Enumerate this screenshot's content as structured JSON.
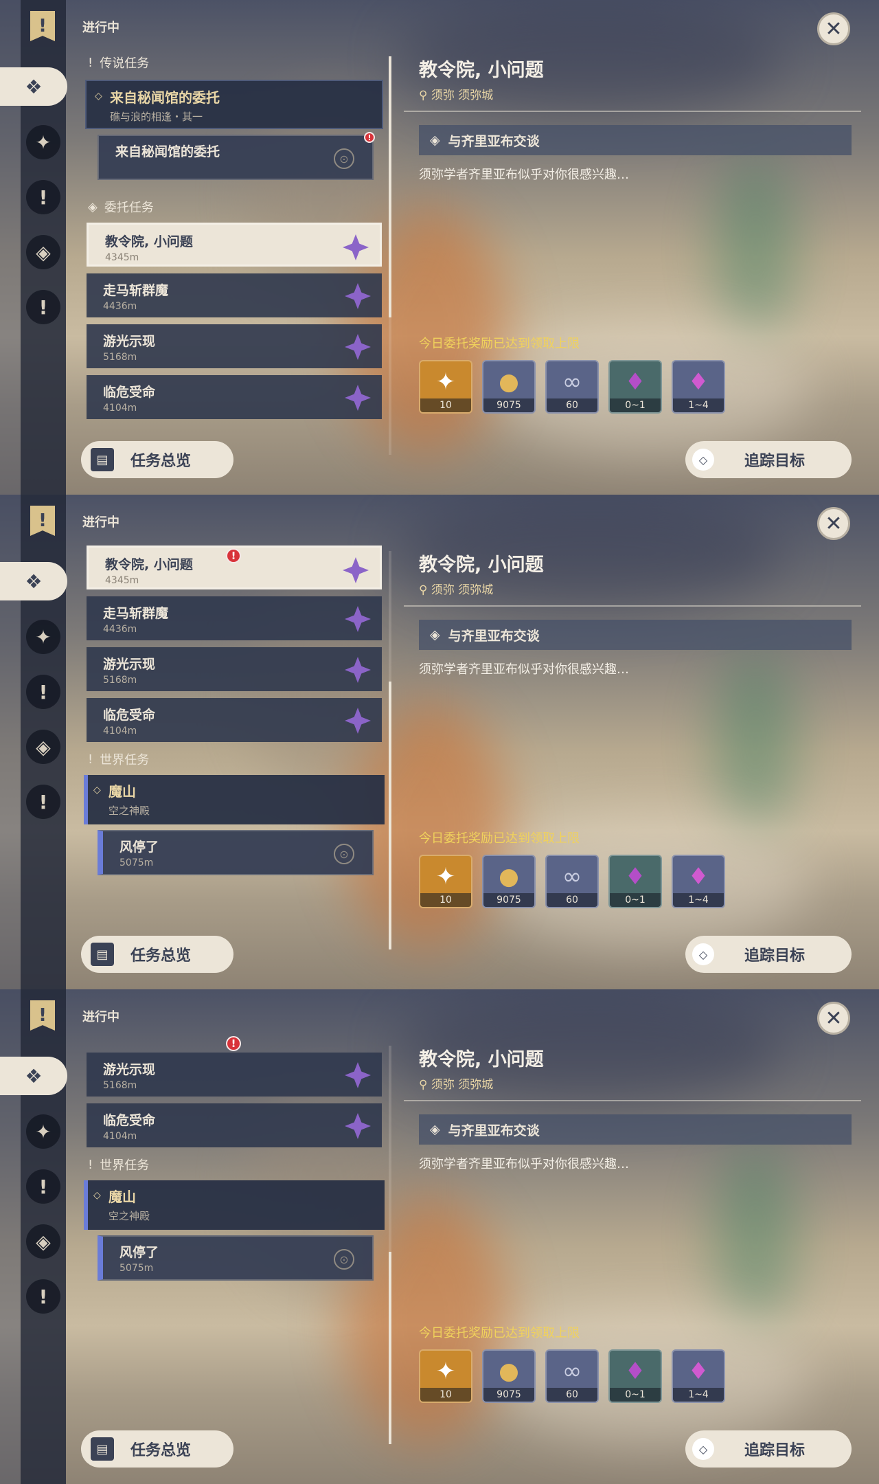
{
  "ui": {
    "status": "进行中",
    "sections": {
      "legend": "传说任务",
      "commission": "委托任务",
      "world": "世界任务"
    },
    "legend_quest": {
      "title": "来自秘闻馆的委托",
      "subtitle": "礁与浪的相逢・其一",
      "step": "来自秘闻馆的委托"
    },
    "commissions": [
      {
        "title": "教令院, 小问题",
        "distance": "4345m"
      },
      {
        "title": "走马斩群魔",
        "distance": "4436m"
      },
      {
        "title": "游光示现",
        "distance": "5168m"
      },
      {
        "title": "临危受命",
        "distance": "4104m"
      }
    ],
    "world_quest": {
      "title": "魔山",
      "subtitle": "空之神殿",
      "step": "风停了",
      "step_distance": "5075m"
    },
    "detail": {
      "title": "教令院, 小问题",
      "location": "须弥 须弥城",
      "objective": "与齐里亚布交谈",
      "description": "须弥学者齐里亚布似乎对你很感兴趣…",
      "reward_limit": "今日委托奖励已达到领取上限",
      "rewards": [
        {
          "icon": "intertwined-fate-star-icon",
          "count": "10",
          "color": "#c9892e"
        },
        {
          "icon": "mora-coin-icon",
          "count": "9075",
          "color": "#5a6488"
        },
        {
          "icon": "friendship-ring-icon",
          "count": "60",
          "color": "#5a6488"
        },
        {
          "icon": "purple-crystal-icon",
          "count": "0~1",
          "color": "#4a6a6a"
        },
        {
          "icon": "purple-crystal-cluster-icon",
          "count": "1~4",
          "color": "#5a6488"
        }
      ]
    },
    "buttons": {
      "overview": "任务总览",
      "track": "追踪目标"
    },
    "colors": {
      "accent": "#ece5d8",
      "limit_text": "#f0d25c",
      "commission_star": "#8b64c8",
      "alert": "#d8333a"
    },
    "icons": {
      "rail_flag": "quest-flag-icon",
      "rail_selected": "all-quests-icon",
      "rail_2": "archon-quest-icon",
      "rail_3": "story-quest-icon",
      "rail_4": "commission-quest-icon",
      "rail_5": "world-quest-icon"
    }
  }
}
